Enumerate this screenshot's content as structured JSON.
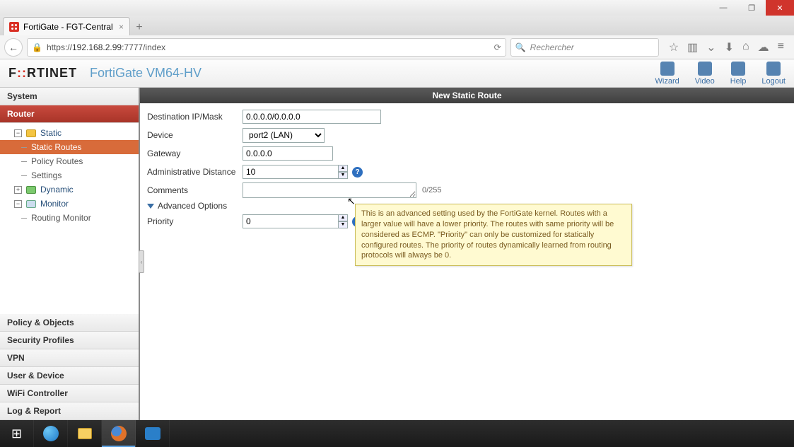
{
  "browser": {
    "tab_title": "FortiGate - FGT-Central",
    "url_prefix": "https://",
    "url_host": "192.168.2.99",
    "url_path": ":7777/index",
    "search_placeholder": "Rechercher"
  },
  "header": {
    "device": "FortiGate VM64-HV",
    "actions": {
      "wizard": "Wizard",
      "video": "Video",
      "help": "Help",
      "logout": "Logout"
    }
  },
  "sidebar": {
    "system": "System",
    "router": "Router",
    "static": "Static",
    "static_routes": "Static Routes",
    "policy_routes": "Policy Routes",
    "settings": "Settings",
    "dynamic": "Dynamic",
    "monitor": "Monitor",
    "routing_monitor": "Routing Monitor",
    "policy_objects": "Policy & Objects",
    "security_profiles": "Security Profiles",
    "vpn": "VPN",
    "user_device": "User & Device",
    "wifi_controller": "WiFi Controller",
    "log_report": "Log & Report"
  },
  "panel": {
    "title": "New Static Route",
    "dest_label": "Destination IP/Mask",
    "dest_value": "0.0.0.0/0.0.0.0",
    "device_label": "Device",
    "device_value": "port2 (LAN)",
    "gateway_label": "Gateway",
    "gateway_value": "0.0.0.0",
    "adist_label": "Administrative Distance",
    "adist_value": "10",
    "comments_label": "Comments",
    "comments_value": "",
    "comments_counter": "0/255",
    "adv_label": "Advanced Options",
    "priority_label": "Priority",
    "priority_value": "0",
    "tooltip": "This is an advanced setting used by the FortiGate kernel. Routes with a larger value will have a lower priority. The routes with same priority will be considered as ECMP. \"Priority\" can only be customized for statically configured routes. The priority of routes dynamically learned from routing protocols will always be 0."
  }
}
